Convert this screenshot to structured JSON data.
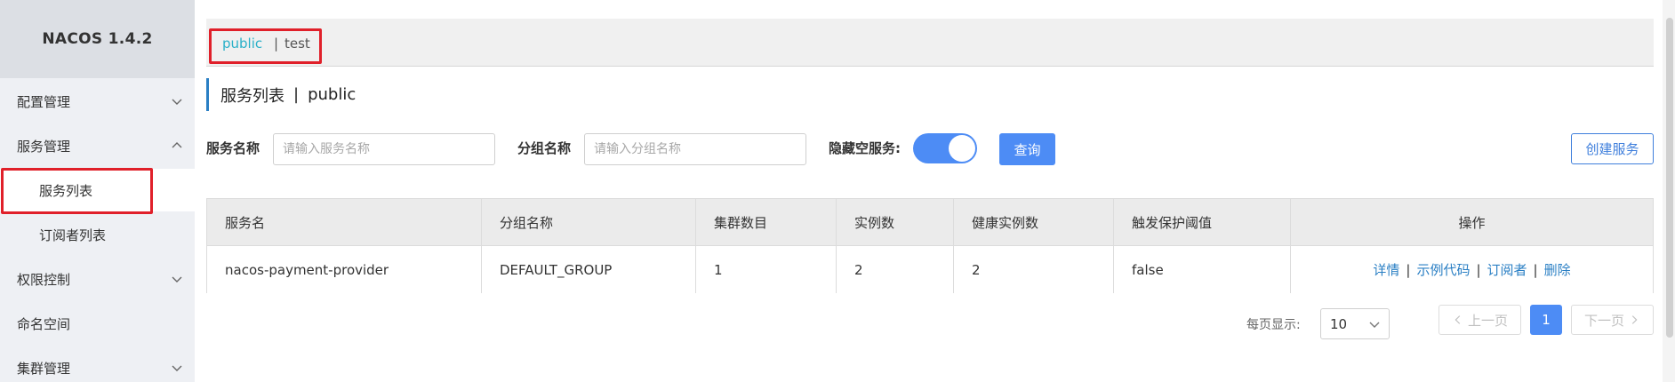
{
  "app": {
    "title": "NACOS 1.4.2"
  },
  "sidebar": {
    "items": [
      {
        "label": "配置管理"
      },
      {
        "label": "服务管理"
      },
      {
        "label": "服务列表"
      },
      {
        "label": "订阅者列表"
      },
      {
        "label": "权限控制"
      },
      {
        "label": "命名空间"
      },
      {
        "label": "集群管理"
      }
    ]
  },
  "namespaces": {
    "active": "public",
    "separator": "|",
    "other": "test"
  },
  "page": {
    "title": "服务列表",
    "separator": "|",
    "namespace": "public"
  },
  "filters": {
    "service_name_label": "服务名称",
    "service_name_placeholder": "请输入服务名称",
    "group_name_label": "分组名称",
    "group_name_placeholder": "请输入分组名称",
    "hide_empty_label": "隐藏空服务:",
    "hide_empty_on": true,
    "query_label": "查询",
    "create_label": "创建服务"
  },
  "table": {
    "columns": [
      "服务名",
      "分组名称",
      "集群数目",
      "实例数",
      "健康实例数",
      "触发保护阈值",
      "操作"
    ],
    "rows": [
      {
        "service": "nacos-payment-provider",
        "group": "DEFAULT_GROUP",
        "clusters": "1",
        "instances": "2",
        "healthy": "2",
        "threshold": "false",
        "actions": [
          "详情",
          "示例代码",
          "订阅者",
          "删除"
        ]
      }
    ]
  },
  "pagination": {
    "page_size_label": "每页显示:",
    "page_size": "10",
    "prev_label": "上一页",
    "current": "1",
    "next_label": "下一页"
  },
  "colors": {
    "accent": "#4d8cf5",
    "link": "#2a7fc4",
    "highlight": "#e0202a",
    "ns_active": "#2ab0c8"
  }
}
